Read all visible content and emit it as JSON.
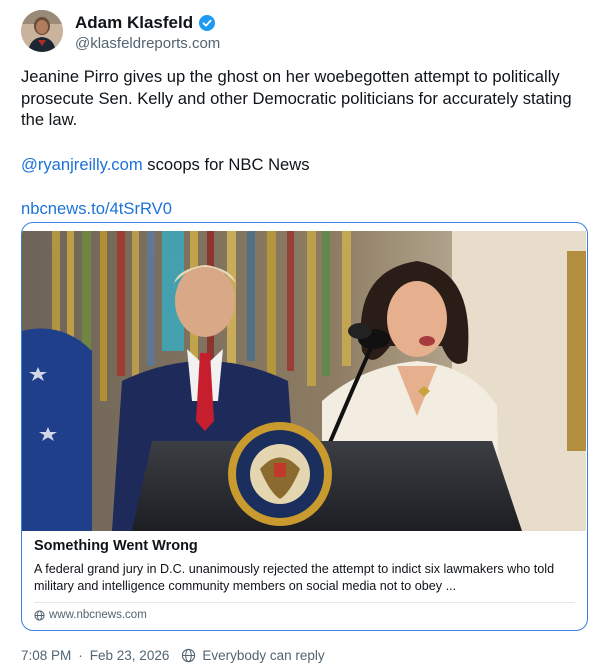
{
  "author": {
    "name": "Adam Klasfeld",
    "handle": "@klasfeldreports.com",
    "verified": true,
    "avatar_icon": "profile-photo"
  },
  "post": {
    "text": "Jeanine Pirro gives up the ghost on her woebegotten attempt to politically prosecute Sen. Kelly and other Democratic politicians for accurately stating the law.",
    "mention": "@ryanjreilly.com",
    "mention_suffix": " scoops for NBC News",
    "url": "nbcnews.to/4tSrRV0"
  },
  "link_card": {
    "title": "Something Went Wrong",
    "description": "A federal grand jury in D.C. unanimously rejected the attempt to indict six lawmakers who told military and intelligence community members on social media not to obey ...",
    "domain": "www.nbcnews.com",
    "domain_icon": "globe-icon"
  },
  "footer": {
    "time": "7:08 PM",
    "separator": "·",
    "date": "Feb 23, 2026",
    "audience_icon": "globe-icon",
    "audience": "Everybody can reply"
  },
  "colors": {
    "link": "#1d72d8",
    "verified": "#1d9bf0",
    "card_border": "#3d7fe0",
    "muted": "#536471"
  }
}
